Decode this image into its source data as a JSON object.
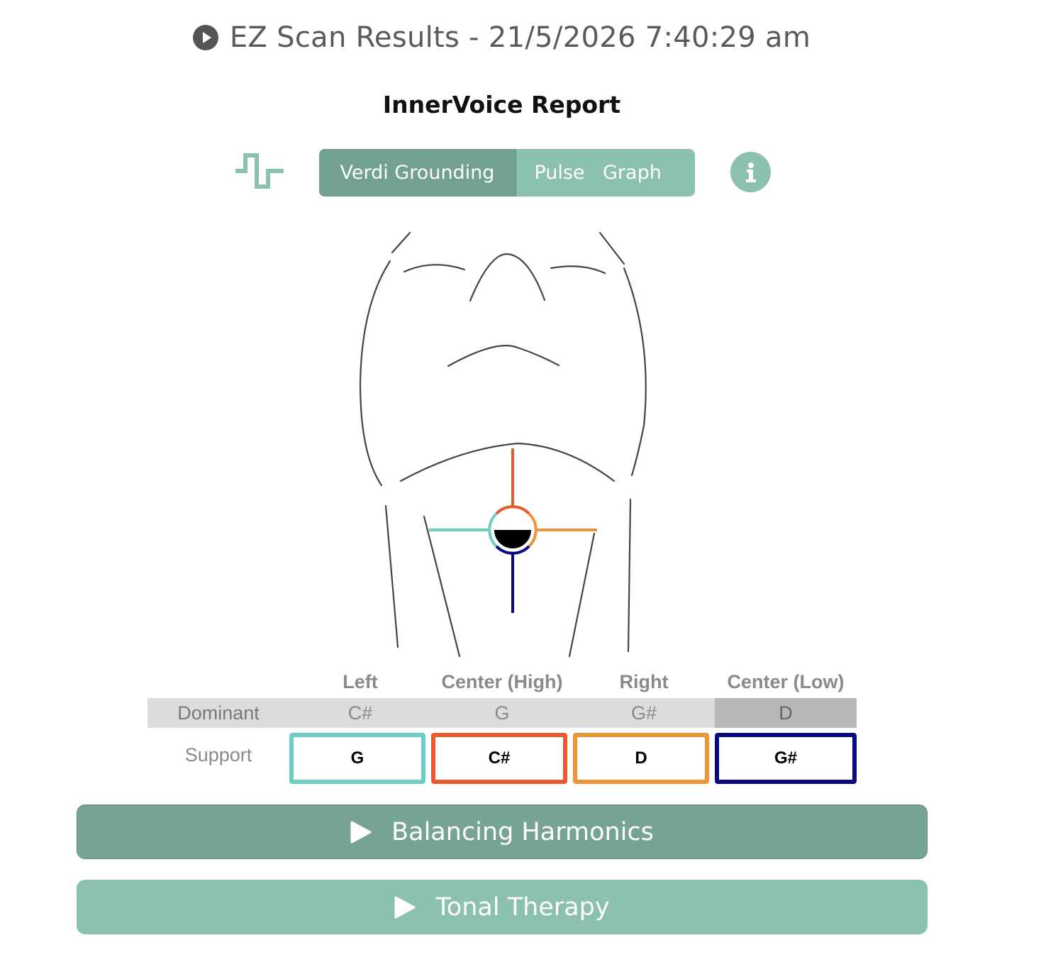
{
  "header": {
    "title": "EZ Scan Results - 21/5/2026 7:40:29 am",
    "icon": "play-circle-icon"
  },
  "report": {
    "title": "InnerVoice Report"
  },
  "toolbar": {
    "pulse_icon": "pulse-wave-icon",
    "tabs": [
      {
        "label": "Verdi Grounding",
        "active": true
      },
      {
        "label": "Pulse",
        "active": false
      },
      {
        "label": "Graph",
        "active": false
      }
    ],
    "info_icon": "info-icon"
  },
  "figure": {
    "name": "neck-outline",
    "colors": {
      "left": "#6ccfc4",
      "center_high": "#e85a2c",
      "right": "#f0943a",
      "center_low": "#0a0a80"
    }
  },
  "table": {
    "columns": [
      "Left",
      "Center (High)",
      "Right",
      "Center (Low)"
    ],
    "dominant": {
      "label": "Dominant",
      "values": [
        "C#",
        "G",
        "G#",
        "D"
      ],
      "highlighted_index": 3
    },
    "support": {
      "label": "Support",
      "values": [
        "G",
        "C#",
        "D",
        "G#"
      ],
      "border_colors": [
        "#6ccfc4",
        "#e85a2c",
        "#f0943a",
        "#0a0a80"
      ]
    }
  },
  "actions": {
    "balancing": {
      "label": "Balancing Harmonics",
      "color": "#76a393"
    },
    "tonal": {
      "label": "Tonal Therapy",
      "color": "#8cc1ae"
    }
  }
}
